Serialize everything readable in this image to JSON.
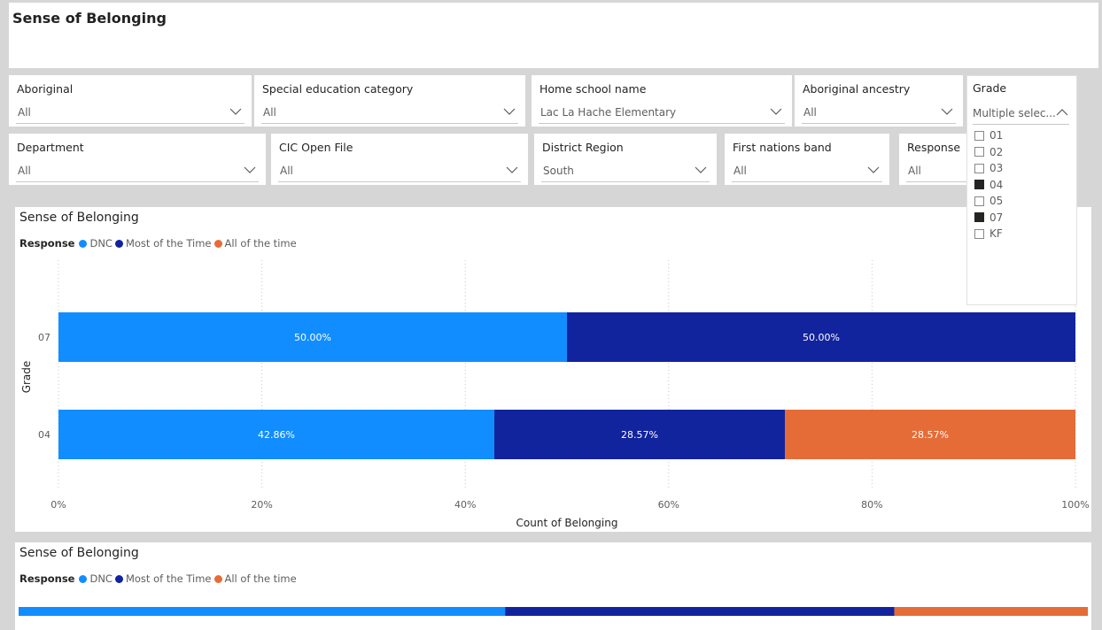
{
  "page": {
    "title": "Sense of Belonging"
  },
  "filters": {
    "row1": [
      {
        "label": "Aboriginal",
        "value": "All"
      },
      {
        "label": "Special education category",
        "value": "All"
      },
      {
        "label": "Home school name",
        "value": "Lac La Hache Elementary"
      },
      {
        "label": "Aboriginal ancestry",
        "value": "All"
      }
    ],
    "row2": [
      {
        "label": "Department",
        "value": "All"
      },
      {
        "label": "CIC Open File",
        "value": "All"
      },
      {
        "label": "District Region",
        "value": "South"
      },
      {
        "label": "First nations band",
        "value": "All"
      },
      {
        "label": "Response",
        "value": "All"
      }
    ],
    "grade": {
      "label": "Grade",
      "value": "Multiple selec...",
      "options": [
        {
          "label": "01",
          "checked": false
        },
        {
          "label": "02",
          "checked": false
        },
        {
          "label": "03",
          "checked": false
        },
        {
          "label": "04",
          "checked": true
        },
        {
          "label": "05",
          "checked": false
        },
        {
          "label": "07",
          "checked": true
        },
        {
          "label": "KF",
          "checked": false
        }
      ]
    }
  },
  "colors": {
    "DNC": "#118dff",
    "Most of the Time": "#12239e",
    "All of the time": "#e66c37"
  },
  "legend": {
    "title": "Response",
    "items": [
      {
        "name": "DNC",
        "color": "#118dff"
      },
      {
        "name": "Most of the Time",
        "color": "#12239e"
      },
      {
        "name": "All of the time",
        "color": "#e66c37"
      }
    ]
  },
  "chart_data": [
    {
      "type": "bar",
      "orientation": "horizontal",
      "stacked": "100%",
      "title": "Sense of Belonging",
      "xlabel": "Count of Belonging",
      "ylabel": "Grade",
      "categories": [
        "07",
        "04"
      ],
      "series": [
        {
          "name": "DNC",
          "values": [
            50.0,
            42.86
          ],
          "labels": [
            "50.00%",
            "42.86%"
          ]
        },
        {
          "name": "Most of the Time",
          "values": [
            50.0,
            28.57
          ],
          "labels": [
            "50.00%",
            "28.57%"
          ]
        },
        {
          "name": "All of the time",
          "values": [
            0,
            28.57
          ],
          "labels": [
            "",
            "28.57%"
          ]
        }
      ],
      "xticks": [
        "0%",
        "20%",
        "40%",
        "60%",
        "80%",
        "100%"
      ],
      "xlim": [
        0,
        100
      ],
      "legend_title": "Response",
      "legend_position": "top-left",
      "grid": "vertical-dotted"
    },
    {
      "type": "bar",
      "orientation": "horizontal",
      "stacked": "100%",
      "title": "Sense of Belonging",
      "series": [
        {
          "name": "DNC",
          "values": [
            45.5
          ]
        },
        {
          "name": "Most of the Time",
          "values": [
            36.4
          ]
        },
        {
          "name": "All of the time",
          "values": [
            18.1
          ]
        }
      ],
      "legend_title": "Response",
      "legend_position": "top-left"
    }
  ]
}
